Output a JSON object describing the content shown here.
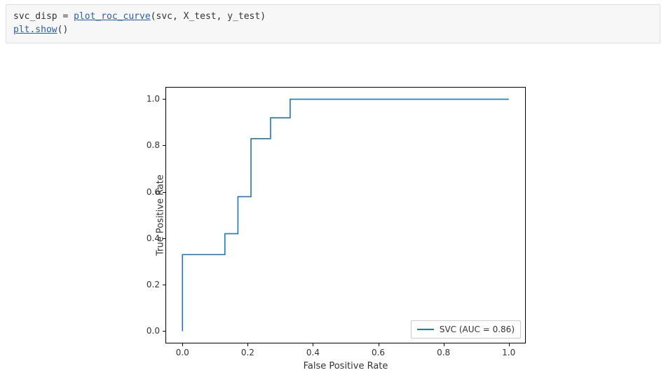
{
  "code": {
    "line1_prefix": "svc_disp = ",
    "line1_link": "plot_roc_curve",
    "line1_suffix": "(svc, X_test, y_test)",
    "line2_link": "plt.show",
    "line2_suffix": "()"
  },
  "chart_data": {
    "type": "line",
    "title": "",
    "xlabel": "False Positive Rate",
    "ylabel": "True Positive Rate",
    "xlim": [
      -0.05,
      1.05
    ],
    "ylim": [
      -0.05,
      1.05
    ],
    "xticks": [
      0.0,
      0.2,
      0.4,
      0.6,
      0.8,
      1.0
    ],
    "yticks": [
      0.0,
      0.2,
      0.4,
      0.6,
      0.8,
      1.0
    ],
    "xtick_labels": [
      "0.0",
      "0.2",
      "0.4",
      "0.6",
      "0.8",
      "1.0"
    ],
    "ytick_labels": [
      "0.0",
      "0.2",
      "0.4",
      "0.6",
      "0.8",
      "1.0"
    ],
    "line_color": "#1f77b4",
    "series": [
      {
        "name": "SVC (AUC = 0.86)",
        "step": "post",
        "x": [
          0.0,
          0.0,
          0.13,
          0.13,
          0.17,
          0.17,
          0.21,
          0.21,
          0.27,
          0.27,
          0.33,
          0.33,
          1.0
        ],
        "y": [
          0.0,
          0.33,
          0.33,
          0.42,
          0.42,
          0.58,
          0.58,
          0.83,
          0.83,
          0.92,
          0.92,
          1.0,
          1.0
        ]
      }
    ],
    "legend": {
      "position": "lower right",
      "label": "SVC (AUC = 0.86)"
    }
  }
}
